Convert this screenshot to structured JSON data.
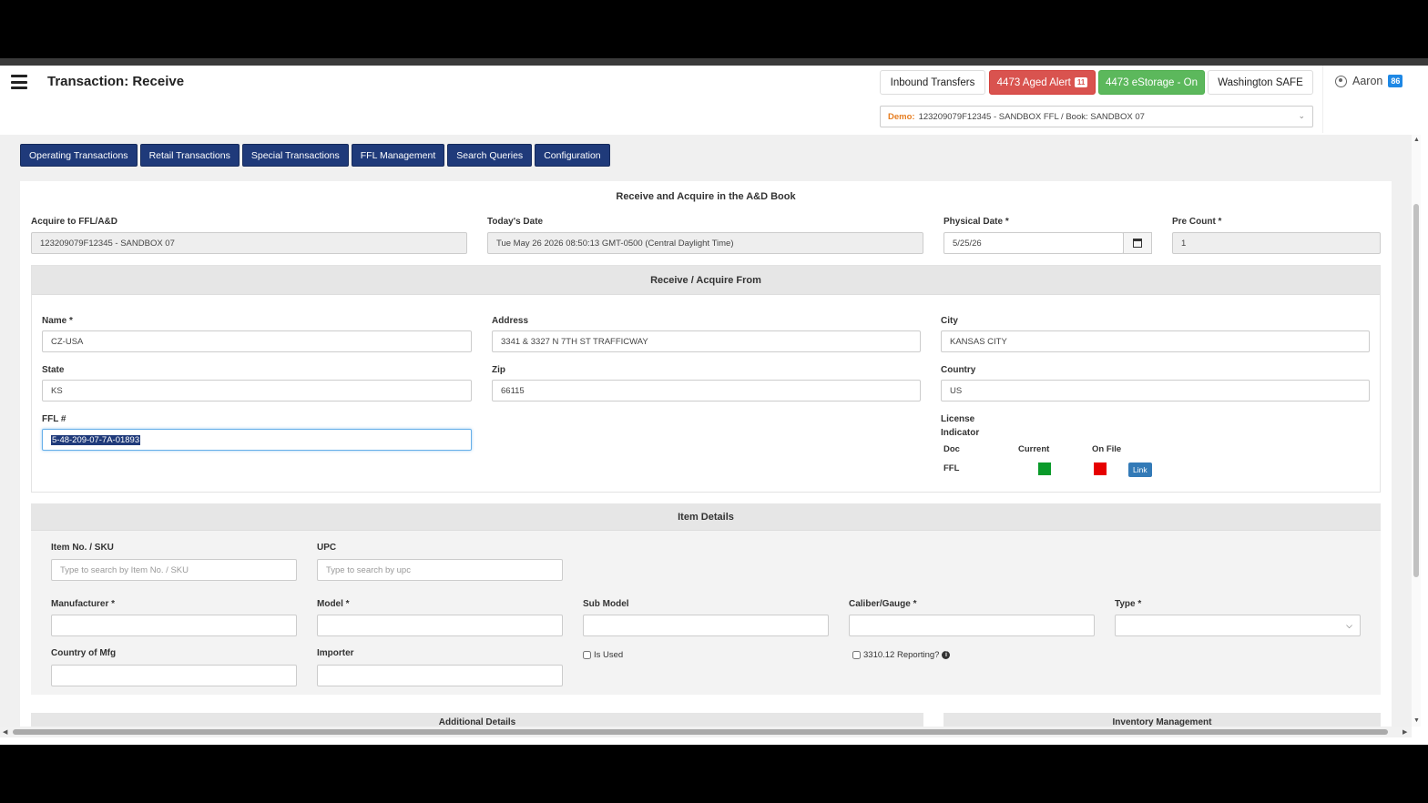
{
  "header": {
    "title": "Transaction: Receive",
    "inbound_transfers": "Inbound Transfers",
    "aged_alert": "4473 Aged Alert",
    "aged_alert_count": "11",
    "estorage": "4473 eStorage - On",
    "state_safe": "Washington SAFE",
    "user_name": "Aaron",
    "user_badge": "86",
    "book_prefix": "Demo:",
    "book_value": "123209079F12345 - SANDBOX FFL / Book: SANDBOX 07"
  },
  "nav_tabs": [
    {
      "label": "Operating Transactions"
    },
    {
      "label": "Retail Transactions"
    },
    {
      "label": "Special Transactions"
    },
    {
      "label": "FFL Management"
    },
    {
      "label": "Search Queries"
    },
    {
      "label": "Configuration"
    }
  ],
  "form": {
    "title": "Receive and Acquire in the A&D Book",
    "acquire_label": "Acquire to FFL/A&D",
    "acquire_value": "123209079F12345 - SANDBOX 07",
    "today_label": "Today's Date",
    "today_value": "Tue May 26 2026 08:50:13 GMT-0500 (Central Daylight Time)",
    "physical_label": "Physical Date *",
    "physical_value": "5/25/26",
    "precount_label": "Pre Count *",
    "precount_value": "1"
  },
  "receive_from": {
    "heading": "Receive / Acquire From",
    "name_label": "Name *",
    "name_value": "CZ-USA",
    "address_label": "Address",
    "address_value": "3341 & 3327 N 7TH ST TRAFFICWAY",
    "city_label": "City",
    "city_value": "KANSAS CITY",
    "state_label": "State",
    "state_value": "KS",
    "zip_label": "Zip",
    "zip_value": "66115",
    "country_label": "Country",
    "country_value": "US",
    "ffl_label": "FFL #",
    "ffl_value": "5-48-209-07-7A-01893",
    "license_label_1": "License",
    "license_label_2": "Indicator",
    "col_doc": "Doc",
    "col_current": "Current",
    "col_onfile": "On File",
    "row_doc": "FFL",
    "current_color": "#0a9a2a",
    "onfile_color": "#e60000",
    "link_label": "Link"
  },
  "item_details": {
    "heading": "Item Details",
    "sku_label": "Item No. / SKU",
    "sku_placeholder": "Type to search by Item No. / SKU",
    "upc_label": "UPC",
    "upc_placeholder": "Type to search by upc",
    "manufacturer_label": "Manufacturer *",
    "model_label": "Model *",
    "submodel_label": "Sub Model",
    "caliber_label": "Caliber/Gauge *",
    "type_label": "Type *",
    "country_mfg_label": "Country of Mfg",
    "importer_label": "Importer",
    "is_used_label": "Is Used",
    "reporting_label": "3310.12 Reporting?"
  },
  "bottom": {
    "additional": "Additional Details",
    "inventory": "Inventory Management"
  }
}
